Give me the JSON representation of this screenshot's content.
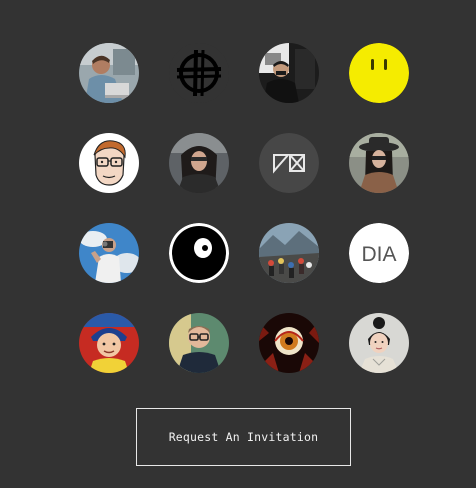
{
  "avatars": [
    {
      "name": "avatar-man-on-laptop",
      "kind": "photo"
    },
    {
      "name": "avatar-crosshair-logo",
      "kind": "icon"
    },
    {
      "name": "avatar-man-at-desk",
      "kind": "photo"
    },
    {
      "name": "avatar-smiley-face",
      "kind": "icon"
    },
    {
      "name": "avatar-cartoon-glasses",
      "kind": "illustration"
    },
    {
      "name": "avatar-woman-dark-hair",
      "kind": "photo"
    },
    {
      "name": "avatar-geometric-logo",
      "kind": "icon"
    },
    {
      "name": "avatar-woman-hat",
      "kind": "photo"
    },
    {
      "name": "avatar-photographer-sky",
      "kind": "photo"
    },
    {
      "name": "avatar-eyeball-logo",
      "kind": "icon"
    },
    {
      "name": "avatar-group-mountain",
      "kind": "photo"
    },
    {
      "name": "avatar-dia-logo",
      "kind": "text-logo",
      "text": "DIA"
    },
    {
      "name": "avatar-child-red",
      "kind": "photo"
    },
    {
      "name": "avatar-man-glasses",
      "kind": "photo"
    },
    {
      "name": "avatar-monster-eye",
      "kind": "illustration"
    },
    {
      "name": "avatar-woman-bun",
      "kind": "photo"
    }
  ],
  "invite_button": {
    "label": "Request An Invitation"
  },
  "colors": {
    "background": "#333333",
    "button_border": "#e8e8e8",
    "button_text": "#f2f2f2",
    "smiley_yellow": "#f5ec00"
  }
}
